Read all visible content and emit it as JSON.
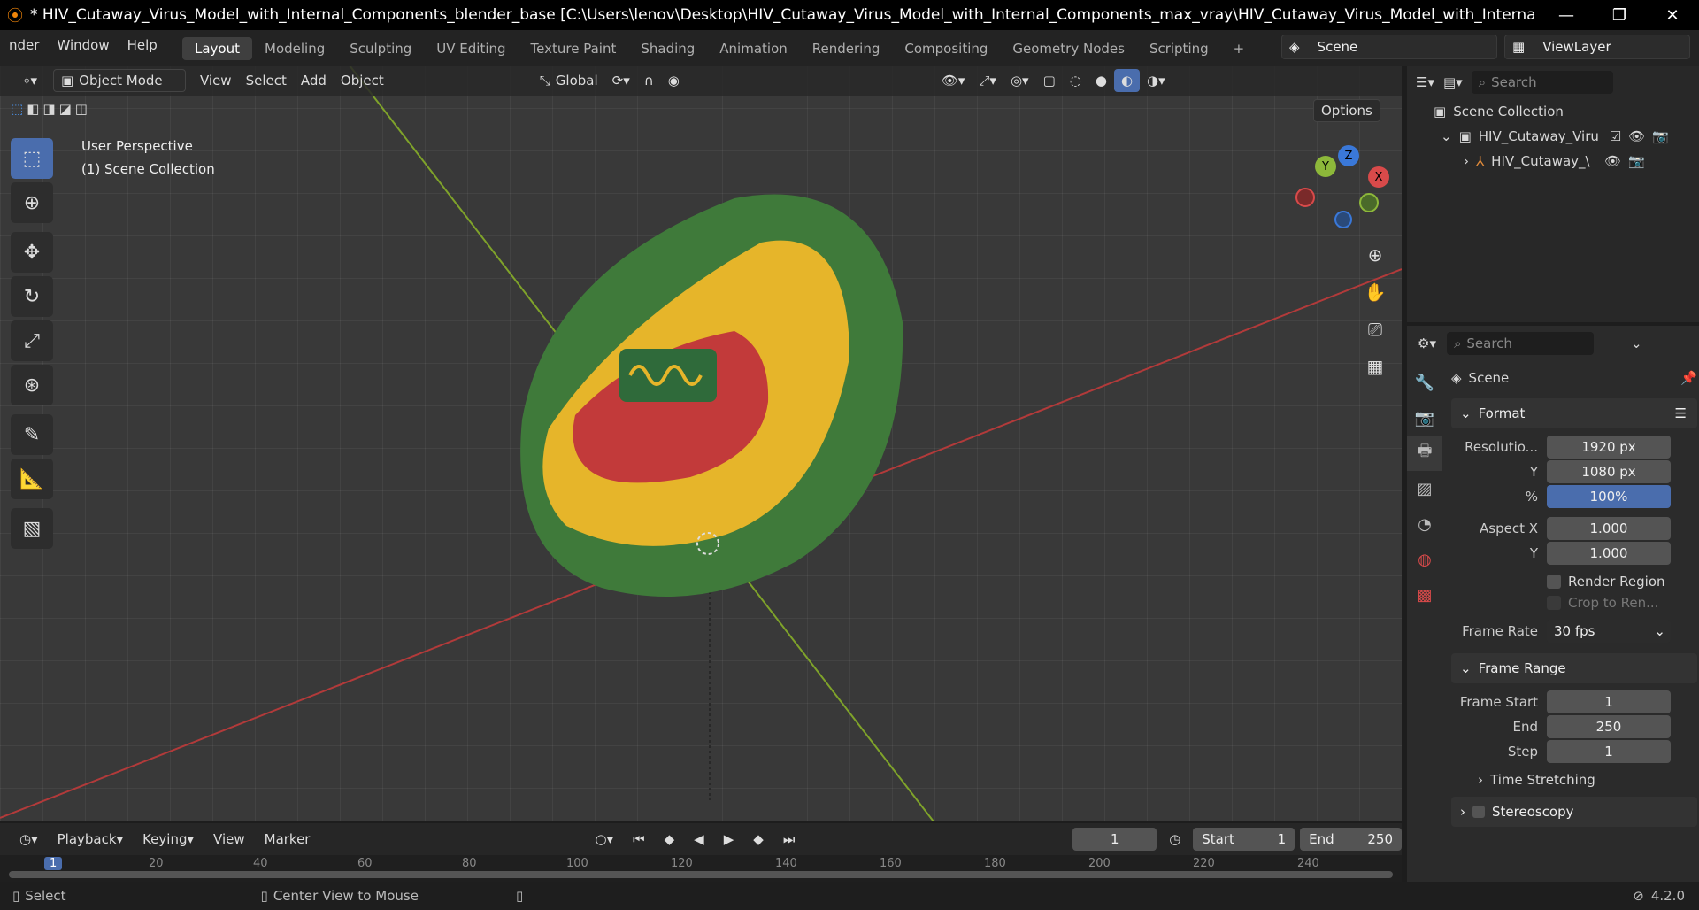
{
  "window": {
    "title": "* HIV_Cutaway_Virus_Model_with_Internal_Components_blender_base [C:\\Users\\lenov\\Desktop\\HIV_Cutaway_Virus_Model_with_Internal_Components_max_vray\\HIV_Cutaway_Virus_Model_with_Internal_Components_blender...",
    "minimize": "—",
    "restore": "❐",
    "close": "✕"
  },
  "menu": [
    "nder",
    "Window",
    "Help"
  ],
  "workspaces": [
    "Layout",
    "Modeling",
    "Sculpting",
    "UV Editing",
    "Texture Paint",
    "Shading",
    "Animation",
    "Rendering",
    "Compositing",
    "Geometry Nodes",
    "Scripting"
  ],
  "add_workspace": "+",
  "scene_name": "Scene",
  "view_layer": "ViewLayer",
  "viewport": {
    "mode": "Object Mode",
    "menus": [
      "View",
      "Select",
      "Add",
      "Object"
    ],
    "transform": "Global",
    "options": "Options",
    "perspective": "User Perspective",
    "collection": "(1) Scene Collection",
    "gizmo": {
      "x": "X",
      "y": "Y",
      "z": "Z"
    }
  },
  "outliner": {
    "search": "Search",
    "root": "Scene Collection",
    "child1": "HIV_Cutaway_Viru",
    "child2": "HIV_Cutaway_\\"
  },
  "props": {
    "search": "Search",
    "context": "Scene",
    "format_title": "Format",
    "res_label": "Resolutio...",
    "res_x": "1920 px",
    "y_label": "Y",
    "res_y": "1080 px",
    "pct_label": "%",
    "pct": "100%",
    "aspect_label": "Aspect X",
    "aspect_x": "1.000",
    "aspect_y_label": "Y",
    "aspect_y": "1.000",
    "render_region": "Render Region",
    "crop": "Crop to Ren...",
    "fr_label": "Frame Rate",
    "fr": "30 fps",
    "range_title": "Frame Range",
    "fs_label": "Frame Start",
    "fs": "1",
    "end_label": "End",
    "end": "250",
    "step_label": "Step",
    "step": "1",
    "time_stretching": "Time Stretching",
    "stereoscopy": "Stereoscopy"
  },
  "timeline": {
    "menus": [
      "Playback",
      "Keying",
      "View",
      "Marker"
    ],
    "current": "1",
    "start_label": "Start",
    "start": "1",
    "end_label": "End",
    "end": "250",
    "ticks": [
      "1",
      "20",
      "40",
      "60",
      "80",
      "100",
      "120",
      "140",
      "160",
      "180",
      "200",
      "220",
      "240"
    ]
  },
  "status": {
    "select": "Select",
    "center": "Center View to Mouse",
    "version": "4.2.0"
  },
  "colors": {
    "accent": "#4a6dad",
    "virus_outer": "#3f7a3a",
    "virus_inner": "#e6b52a",
    "capsid": "#c23a3a"
  }
}
